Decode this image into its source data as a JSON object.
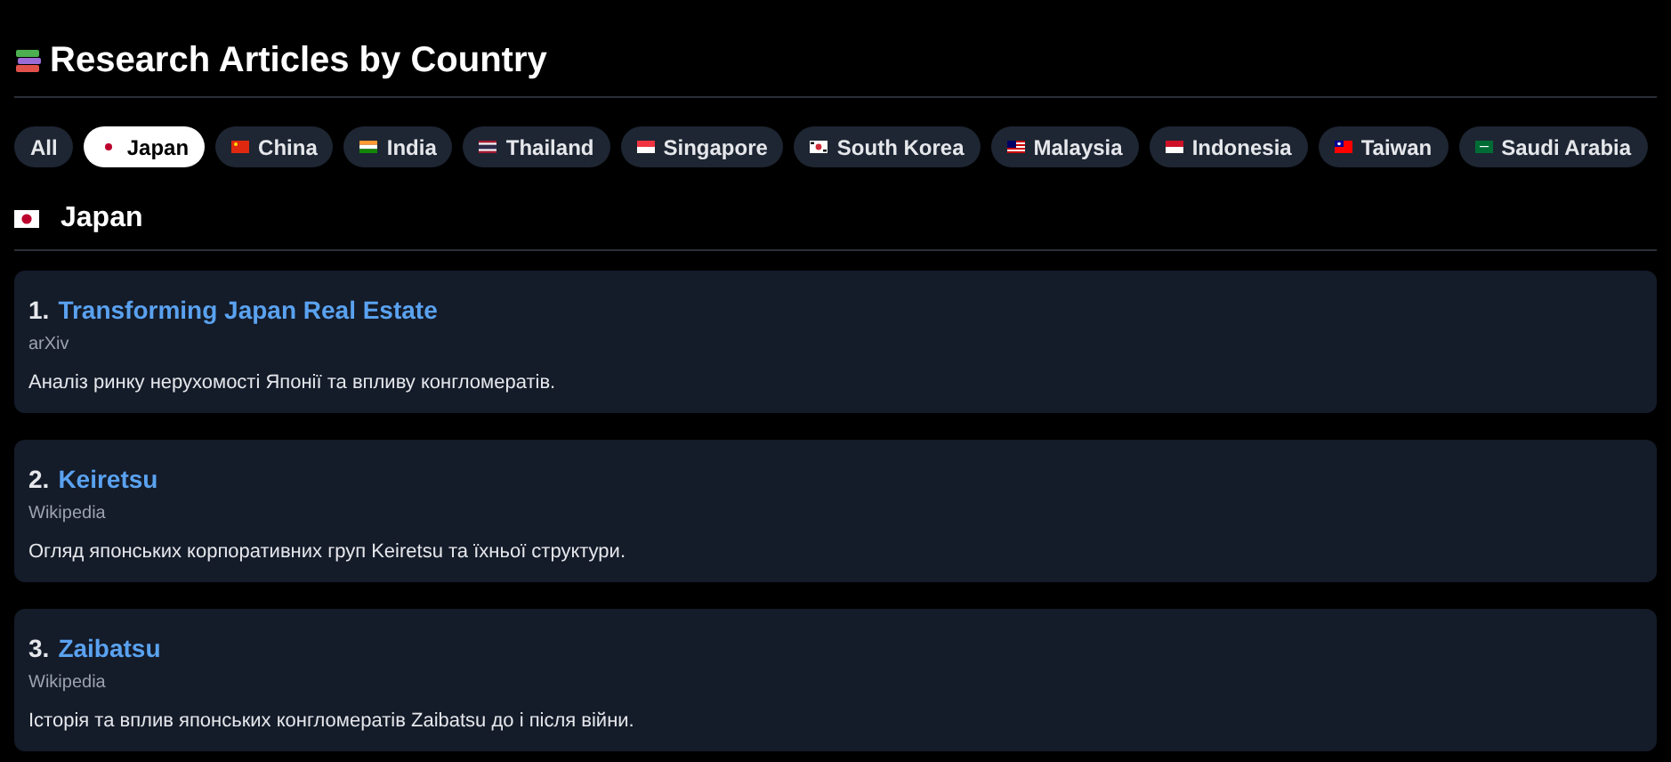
{
  "title": "Research Articles by Country",
  "filters": [
    {
      "label": "All",
      "selected": false
    },
    {
      "label": "Japan",
      "selected": true
    },
    {
      "label": "China",
      "selected": false
    },
    {
      "label": "India",
      "selected": false
    },
    {
      "label": "Thailand",
      "selected": false
    },
    {
      "label": "Singapore",
      "selected": false
    },
    {
      "label": "South Korea",
      "selected": false
    },
    {
      "label": "Malaysia",
      "selected": false
    },
    {
      "label": "Indonesia",
      "selected": false
    },
    {
      "label": "Taiwan",
      "selected": false
    },
    {
      "label": "Saudi Arabia",
      "selected": false
    }
  ],
  "section": {
    "heading": "Japan"
  },
  "articles": [
    {
      "number": "1.",
      "title": "Transforming Japan Real Estate",
      "source": "arXiv",
      "summary": "Аналіз ринку нерухомості Японії та впливу конгломератів."
    },
    {
      "number": "2.",
      "title": "Keiretsu",
      "source": "Wikipedia",
      "summary": "Огляд японських корпоративних груп Keiretsu та їхньої структури."
    },
    {
      "number": "3.",
      "title": "Zaibatsu",
      "source": "Wikipedia",
      "summary": "Історія та вплив японських конгломератів Zaibatsu до і після війни."
    }
  ]
}
